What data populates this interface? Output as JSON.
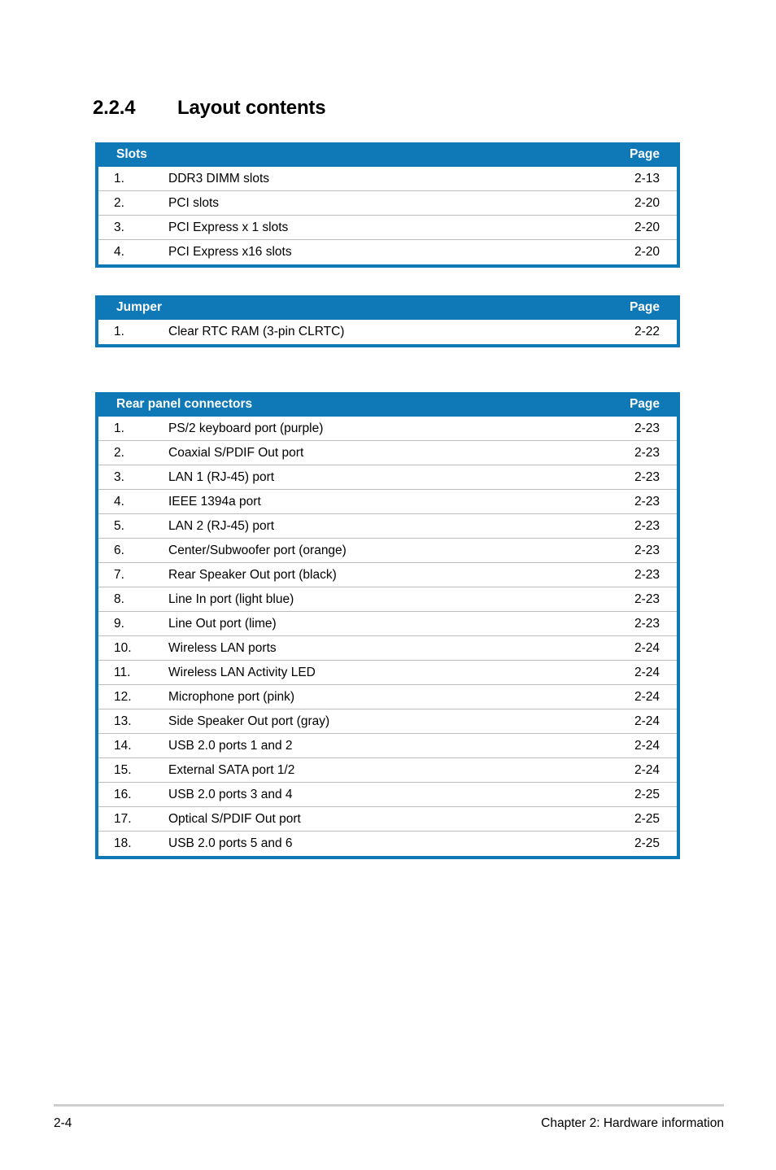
{
  "heading": {
    "number": "2.2.4",
    "title": "Layout contents"
  },
  "colors": {
    "header_blue": "#0f79b8",
    "row_separator": "#bdbdbd",
    "footer_rule": "#cfcfcf"
  },
  "tables": [
    {
      "header_label": "Slots",
      "header_page": "Page",
      "rows": [
        {
          "num": "1.",
          "desc": "DDR3 DIMM slots",
          "page": "2-13"
        },
        {
          "num": "2.",
          "desc": "PCI slots",
          "page": "2-20"
        },
        {
          "num": "3.",
          "desc": "PCI Express x 1 slots",
          "page": "2-20"
        },
        {
          "num": "4.",
          "desc": "PCI Express x16 slots",
          "page": "2-20"
        }
      ]
    },
    {
      "header_label": "Jumper",
      "header_page": "Page",
      "rows": [
        {
          "num": "1.",
          "desc": "Clear RTC RAM (3-pin CLRTC)",
          "page": "2-22"
        }
      ]
    },
    {
      "header_label": "Rear panel connectors",
      "header_page": "Page",
      "rows": [
        {
          "num": "1.",
          "desc": "PS/2 keyboard port (purple)",
          "page": "2-23"
        },
        {
          "num": "2.",
          "desc": "Coaxial S/PDIF Out port",
          "page": "2-23"
        },
        {
          "num": "3.",
          "desc": "LAN 1 (RJ-45) port",
          "page": "2-23"
        },
        {
          "num": "4.",
          "desc": "IEEE 1394a port",
          "page": "2-23"
        },
        {
          "num": "5.",
          "desc": "LAN 2 (RJ-45) port",
          "page": "2-23"
        },
        {
          "num": "6.",
          "desc": "Center/Subwoofer port (orange)",
          "page": "2-23"
        },
        {
          "num": "7.",
          "desc": "Rear Speaker Out port (black)",
          "page": "2-23"
        },
        {
          "num": "8.",
          "desc": "Line In port (light blue)",
          "page": "2-23"
        },
        {
          "num": "9.",
          "desc": "Line Out port (lime)",
          "page": "2-23"
        },
        {
          "num": "10.",
          "desc": "Wireless LAN ports",
          "page": "2-24"
        },
        {
          "num": "11.",
          "desc": "Wireless LAN Activity LED",
          "page": "2-24"
        },
        {
          "num": "12.",
          "desc": "Microphone port (pink)",
          "page": "2-24"
        },
        {
          "num": "13.",
          "desc": "Side Speaker Out port (gray)",
          "page": "2-24"
        },
        {
          "num": "14.",
          "desc": "USB 2.0 ports 1 and 2",
          "page": "2-24"
        },
        {
          "num": "15.",
          "desc": "External SATA port 1/2",
          "page": "2-24"
        },
        {
          "num": "16.",
          "desc": "USB 2.0 ports 3 and 4",
          "page": "2-25"
        },
        {
          "num": "17.",
          "desc": "Optical S/PDIF Out port",
          "page": "2-25"
        },
        {
          "num": "18.",
          "desc": "USB 2.0 ports 5 and 6",
          "page": "2-25"
        }
      ]
    }
  ],
  "footer": {
    "page_number": "2-4",
    "chapter": "Chapter 2: Hardware information"
  }
}
